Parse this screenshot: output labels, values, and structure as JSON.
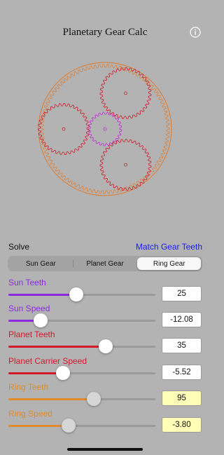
{
  "header": {
    "title": "Planetary Gear Calc",
    "info_icon": "info-circle-icon"
  },
  "gears": {
    "ring_color": "#e07a2a",
    "planet_color": "#d4192a",
    "sun_color": "#c02bd6"
  },
  "solve": {
    "label": "Solve",
    "match_button_label": "Match Gear Teeth",
    "match_button_color": "#1a1aff",
    "segments": [
      "Sun Gear",
      "Planet Gear",
      "Ring Gear"
    ],
    "selected_segment": "Ring Gear"
  },
  "rows": [
    {
      "label": "Sun Teeth",
      "value": "25",
      "color": "#8b2be0",
      "level": 0.46,
      "readonly": false
    },
    {
      "label": "Sun Speed",
      "value": "-12.08",
      "color": "#8b2be0",
      "level": 0.22,
      "readonly": false
    },
    {
      "label": "Planet Teeth",
      "value": "35",
      "color": "#d4192a",
      "level": 0.66,
      "readonly": false
    },
    {
      "label": "Planet Carrier Speed",
      "value": "-5.52",
      "color": "#d4192a",
      "level": 0.37,
      "readonly": false
    },
    {
      "label": "Ring Teeth",
      "value": "95",
      "color": "#e08a2a",
      "level": 0.58,
      "readonly": true
    },
    {
      "label": "Ring Speed",
      "value": "-3.80",
      "color": "#e08a2a",
      "level": 0.41,
      "readonly": true
    }
  ]
}
